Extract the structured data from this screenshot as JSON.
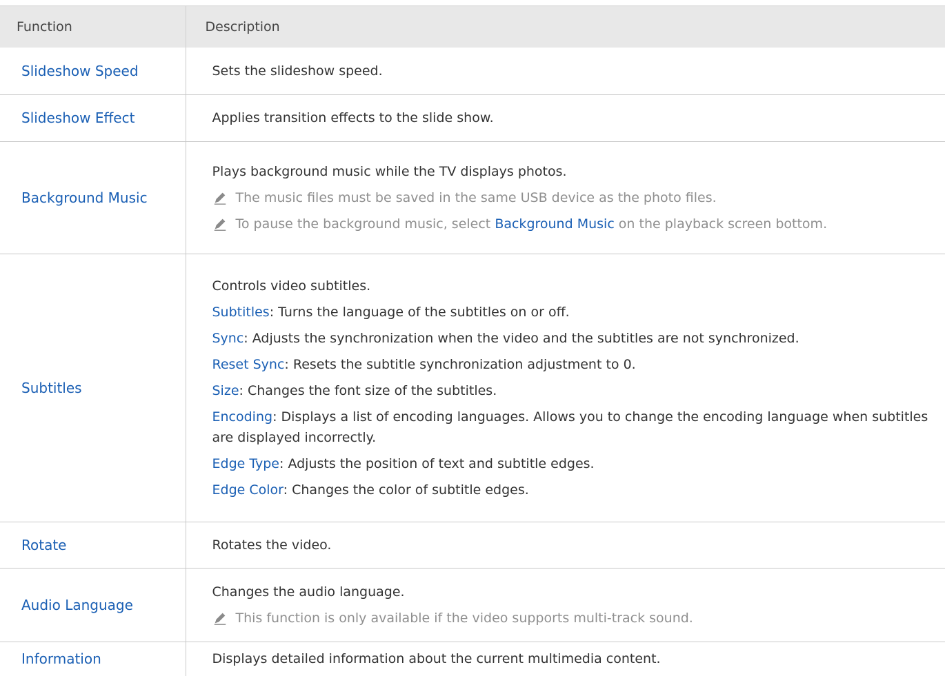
{
  "header": {
    "col1": "Function",
    "col2": "Description"
  },
  "rows": [
    {
      "function": "Slideshow Speed",
      "lines": [
        {
          "text": "Sets the slideshow speed."
        }
      ]
    },
    {
      "function": "Slideshow Effect",
      "lines": [
        {
          "text": "Applies transition effects to the slide show."
        }
      ]
    },
    {
      "function": "Background Music",
      "lines": [
        {
          "text": "Plays background music while the TV displays photos."
        },
        {
          "note": "The music files must be saved in the same USB device as the photo files."
        },
        {
          "note_pre": "To pause the background music, select ",
          "note_term": "Background Music",
          "note_post": " on the playback screen bottom."
        }
      ]
    },
    {
      "function": "Subtitles",
      "lines": [
        {
          "text": "Controls video subtitles."
        },
        {
          "term": "Subtitles",
          "text": ": Turns the language of the subtitles on or off."
        },
        {
          "term": "Sync",
          "text": ": Adjusts the synchronization when the video and the subtitles are not synchronized."
        },
        {
          "term": "Reset Sync",
          "text": ": Resets the subtitle synchronization adjustment to 0."
        },
        {
          "term": "Size",
          "text": ": Changes the font size of the subtitles."
        },
        {
          "term": "Encoding",
          "text": ": Displays a list of encoding languages. Allows you to change the encoding language when subtitles are displayed incorrectly."
        },
        {
          "term": "Edge Type",
          "text": ": Adjusts the position of text and subtitle edges."
        },
        {
          "term": "Edge Color",
          "text": ": Changes the color of subtitle edges."
        }
      ]
    },
    {
      "function": "Rotate",
      "lines": [
        {
          "text": "Rotates the video."
        }
      ]
    },
    {
      "function": "Audio Language",
      "lines": [
        {
          "text": "Changes the audio language."
        },
        {
          "note": "This function is only available if the video supports multi-track sound."
        }
      ]
    },
    {
      "function": "Information",
      "lines": [
        {
          "text": "Displays detailed information about the current multimedia content."
        }
      ]
    }
  ],
  "colors": {
    "accent": "#1a5fb4",
    "note_text": "#8f8f8f",
    "header_bg": "#e8e8e8"
  },
  "icons": {
    "note": "pencil-icon"
  }
}
